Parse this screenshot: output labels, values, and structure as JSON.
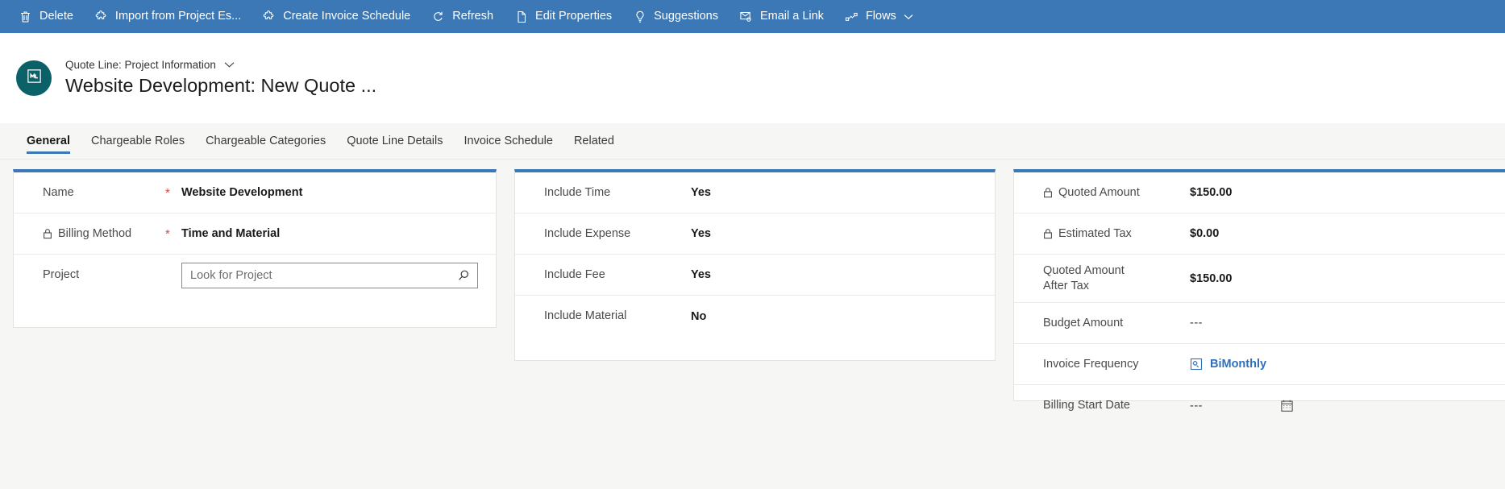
{
  "commandbar": {
    "items": [
      {
        "label": "Delete",
        "icon": "trash-icon",
        "caret": false
      },
      {
        "label": "Import from Project Es...",
        "icon": "puzzle-icon",
        "caret": false
      },
      {
        "label": "Create Invoice Schedule",
        "icon": "puzzle-icon",
        "caret": false
      },
      {
        "label": "Refresh",
        "icon": "refresh-icon",
        "caret": false
      },
      {
        "label": "Edit Properties",
        "icon": "page-icon",
        "caret": false
      },
      {
        "label": "Suggestions",
        "icon": "lightbulb-icon",
        "caret": false
      },
      {
        "label": "Email a Link",
        "icon": "email-icon",
        "caret": false
      },
      {
        "label": "Flows",
        "icon": "flows-icon",
        "caret": true
      }
    ],
    "background": "#3b78b5"
  },
  "header": {
    "avatar_icon": "quote-line-entity-icon",
    "avatar_color": "#0a6168",
    "subtitle": "Quote Line: Project Information",
    "subtitle_caret": "chevron-down-icon",
    "title": "Website Development: New Quote ..."
  },
  "tabs": {
    "items": [
      {
        "label": "General",
        "active": true
      },
      {
        "label": "Chargeable Roles",
        "active": false
      },
      {
        "label": "Chargeable Categories",
        "active": false
      },
      {
        "label": "Quote Line Details",
        "active": false
      },
      {
        "label": "Invoice Schedule",
        "active": false
      },
      {
        "label": "Related",
        "active": false
      }
    ],
    "accent": "#3b78b5"
  },
  "cards": {
    "general": {
      "accent": "#3b78b5",
      "rows": [
        {
          "label": "Name",
          "locked": false,
          "required": true,
          "value": "Website Development",
          "type": "text"
        },
        {
          "label": "Billing Method",
          "locked": true,
          "required": true,
          "value": "Time and Material",
          "type": "text"
        },
        {
          "label": "Project",
          "locked": false,
          "required": false,
          "placeholder": "Look for Project",
          "value": "",
          "type": "lookup",
          "icon": "search-icon"
        }
      ]
    },
    "include": {
      "accent": "#3b78b5",
      "rows": [
        {
          "label": "Include Time",
          "value": "Yes"
        },
        {
          "label": "Include Expense",
          "value": "Yes"
        },
        {
          "label": "Include Fee",
          "value": "Yes"
        },
        {
          "label": "Include Material",
          "value": "No"
        }
      ]
    },
    "amounts": {
      "accent": "#3b78b5",
      "rows": [
        {
          "label": "Quoted Amount",
          "locked": true,
          "value": "$150.00",
          "type": "text"
        },
        {
          "label": "Estimated Tax",
          "locked": true,
          "value": "$0.00",
          "type": "text"
        },
        {
          "label": "Quoted Amount After Tax",
          "label_line1": "Quoted Amount",
          "label_line2": "After Tax",
          "locked": false,
          "value": "$150.00",
          "type": "text"
        },
        {
          "label": "Budget Amount",
          "locked": false,
          "value": "---",
          "type": "dash"
        },
        {
          "label": "Invoice Frequency",
          "locked": false,
          "value": "BiMonthly",
          "type": "entity-link",
          "icon": "entity-record-icon",
          "link_color": "#2f6fba"
        },
        {
          "label": "Billing Start Date",
          "locked": false,
          "value": "---",
          "type": "date",
          "icon": "calendar-icon"
        }
      ]
    }
  }
}
